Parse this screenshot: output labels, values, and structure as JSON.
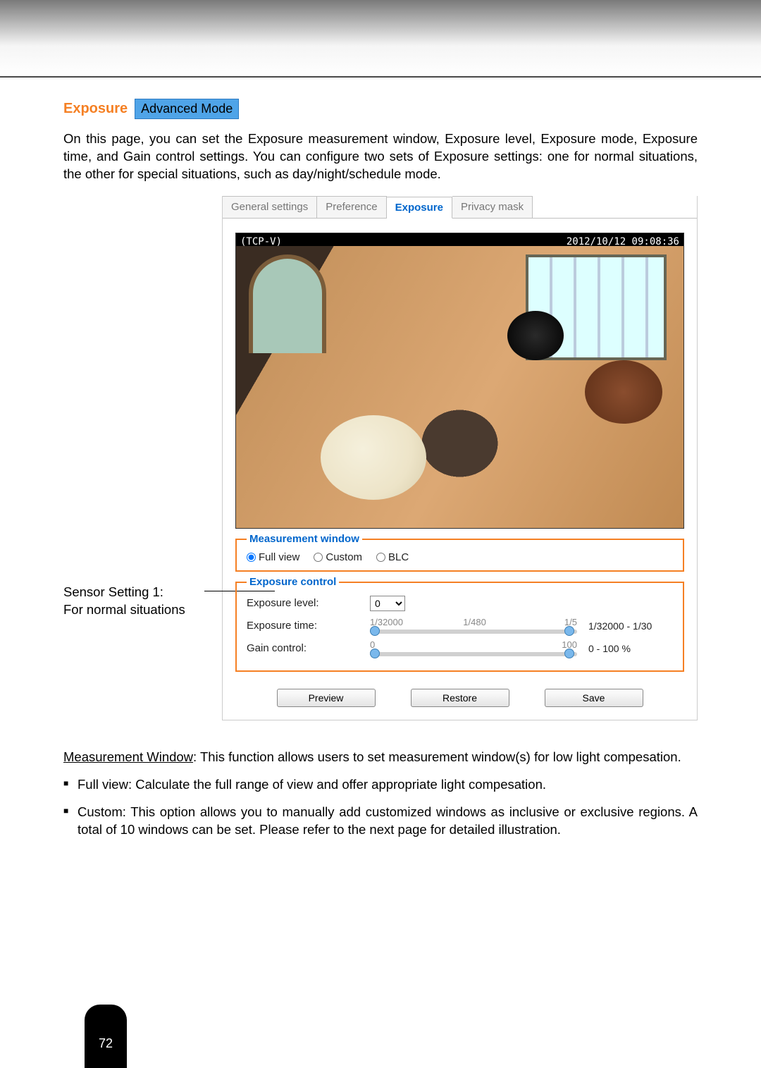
{
  "heading": {
    "title": "Exposure",
    "mode_badge": "Advanced Mode"
  },
  "intro": "On this page, you can set the Exposure measurement window, Exposure level, Exposure mode, Exposure time, and Gain control settings. You can configure two sets of Exposure settings: one for normal situations, the other for special situations, such as day/night/schedule mode.",
  "tabs": {
    "general": "General settings",
    "preference": "Preference",
    "exposure": "Exposure",
    "privacy": "Privacy mask"
  },
  "video": {
    "overlay_left": "(TCP-V)",
    "overlay_right": "2012/10/12 09:08:36"
  },
  "side_label": {
    "line1": "Sensor Setting 1:",
    "line2": "For normal situations"
  },
  "measurement_window": {
    "legend": "Measurement window",
    "options": {
      "full_view": "Full view",
      "custom": "Custom",
      "blc": "BLC"
    },
    "selected": "full_view"
  },
  "exposure_control": {
    "legend": "Exposure control",
    "exposure_level": {
      "label": "Exposure level:",
      "value": "0"
    },
    "exposure_time": {
      "label": "Exposure time:",
      "tick_left": "1/32000",
      "tick_mid": "1/480",
      "tick_right": "1/5",
      "range_label": "1/32000 - 1/30"
    },
    "gain_control": {
      "label": "Gain control:",
      "tick_left": "0",
      "tick_right": "100",
      "range_label": "0 - 100 %"
    }
  },
  "buttons": {
    "preview": "Preview",
    "restore": "Restore",
    "save": "Save"
  },
  "body": {
    "meas_window_label": "Measurement Window",
    "meas_window_text": ": This function allows users to set measurement window(s) for low light compesation.",
    "bullet_full": "Full view: Calculate the full range of view and offer appropriate light compesation.",
    "bullet_custom": "Custom: This option allows you to manually add customized windows as inclusive or exclusive regions. A total of 10 windows can be set. Please refer to the next page for detailed illustration."
  },
  "page_number": "72"
}
